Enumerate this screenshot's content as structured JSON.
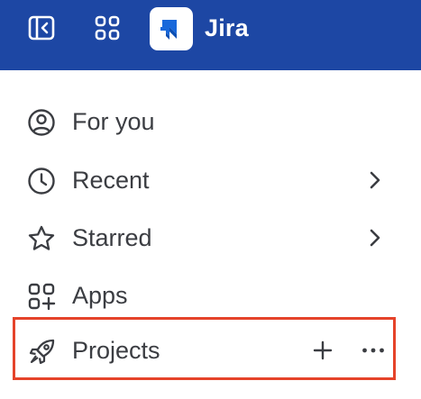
{
  "topbar": {
    "product_name": "Jira",
    "background_color": "#1D47A4",
    "icons": {
      "sidebar_toggle": "sidebar-collapse-icon",
      "app_switcher": "app-switcher-grid-icon",
      "logo": "jira-logo"
    }
  },
  "nav": {
    "items": [
      {
        "label": "For you",
        "icon": "person-circle-icon"
      },
      {
        "label": "Recent",
        "icon": "clock-icon",
        "trailing": "chevron-right-icon"
      },
      {
        "label": "Starred",
        "icon": "star-icon",
        "trailing": "chevron-right-icon"
      },
      {
        "label": "Apps",
        "icon": "apps-add-icon"
      },
      {
        "label": "Projects",
        "icon": "rocket-icon",
        "actions": [
          "plus-icon",
          "more-icon"
        ]
      }
    ]
  },
  "highlight": {
    "target": "Projects",
    "color": "#E5432A"
  }
}
